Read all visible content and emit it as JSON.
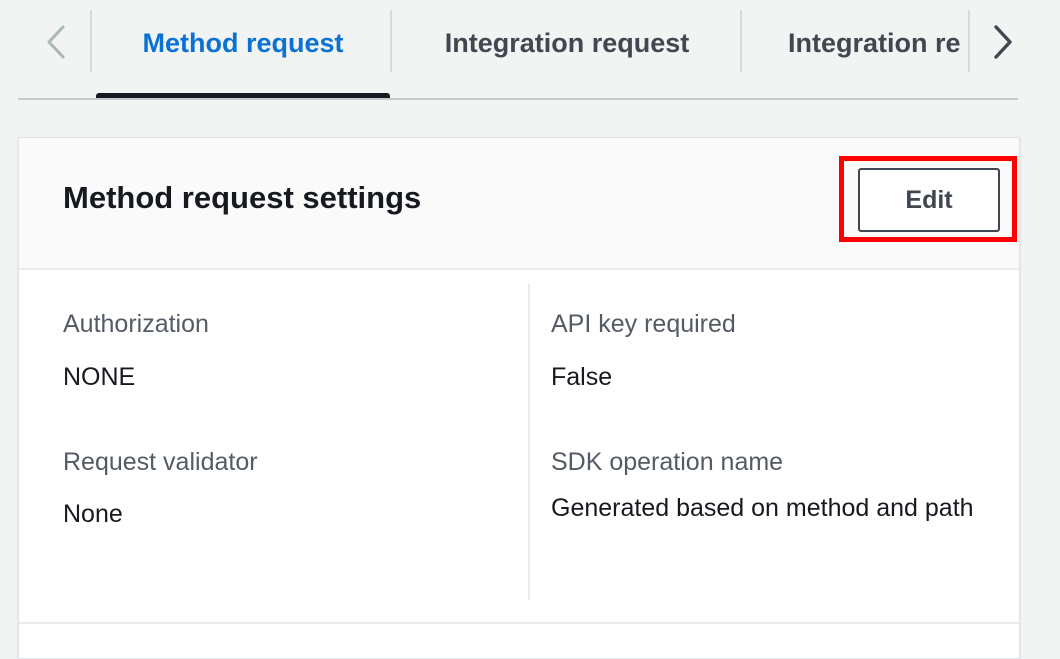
{
  "tabs": {
    "items": [
      {
        "label": "Method request",
        "active": true
      },
      {
        "label": "Integration request",
        "active": false
      },
      {
        "label": "Integration re",
        "active": false
      }
    ],
    "prev_icon": "chevron-left-icon",
    "next_icon": "chevron-right-icon"
  },
  "card": {
    "title": "Method request settings",
    "edit_label": "Edit",
    "highlight_color": "#ff0000",
    "fields": {
      "authorization": {
        "label": "Authorization",
        "value": "NONE"
      },
      "api_key_required": {
        "label": "API key required",
        "value": "False"
      },
      "request_validator": {
        "label": "Request validator",
        "value": "None"
      },
      "sdk_operation_name": {
        "label": "SDK operation name",
        "value": "Generated based on method and path"
      }
    }
  },
  "colors": {
    "accent": "#0972d3",
    "text": "#16191f",
    "label": "#545b64",
    "background": "#f2f3f3"
  }
}
